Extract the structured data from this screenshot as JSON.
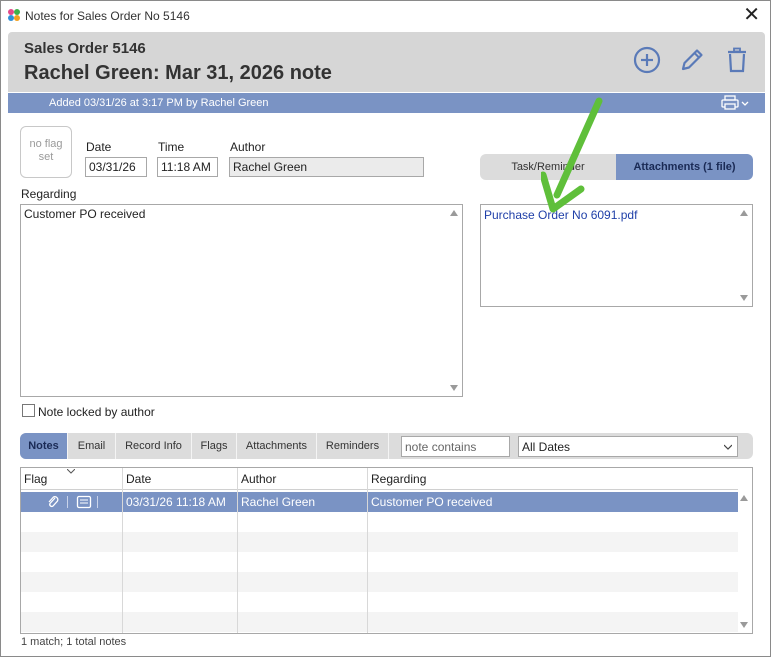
{
  "window": {
    "title": "Notes for Sales Order No 5146"
  },
  "header": {
    "order": "Sales Order 5146",
    "note_title": "Rachel Green: Mar 31, 2026 note",
    "added_by": "Added 03/31/26 at 3:17 PM by Rachel Green"
  },
  "flag": {
    "text1": "no flag",
    "text2": "set"
  },
  "fields": {
    "date_label": "Date",
    "date_value": "03/31/26",
    "time_label": "Time",
    "time_value": "11:18 AM",
    "author_label": "Author",
    "author_value": "Rachel Green",
    "regarding_label": "Regarding",
    "regarding_value": "Customer PO received",
    "locked_label": "Note locked by author"
  },
  "segments": {
    "task": "Task/Reminder",
    "attachments": "Attachments (1 file)"
  },
  "attachments": [
    "Purchase Order No 6091.pdf"
  ],
  "tabs": [
    "Notes",
    "Email",
    "Record Info",
    "Flags",
    "Attachments",
    "Reminders"
  ],
  "filter": {
    "placeholder": "note contains",
    "dates": "All Dates"
  },
  "grid": {
    "headers": [
      "Flag",
      "Date",
      "Author",
      "Regarding"
    ],
    "rows": [
      {
        "date": "03/31/26 11:18 AM",
        "author": "Rachel Green",
        "regarding": "Customer PO received"
      }
    ]
  },
  "status": "1 match; 1 total notes",
  "colors": {
    "accent": "#7a93c4",
    "header_bg": "#d6d6d6",
    "icon_blue": "#5a7ab8",
    "arrow_green": "#5fbf3a"
  }
}
